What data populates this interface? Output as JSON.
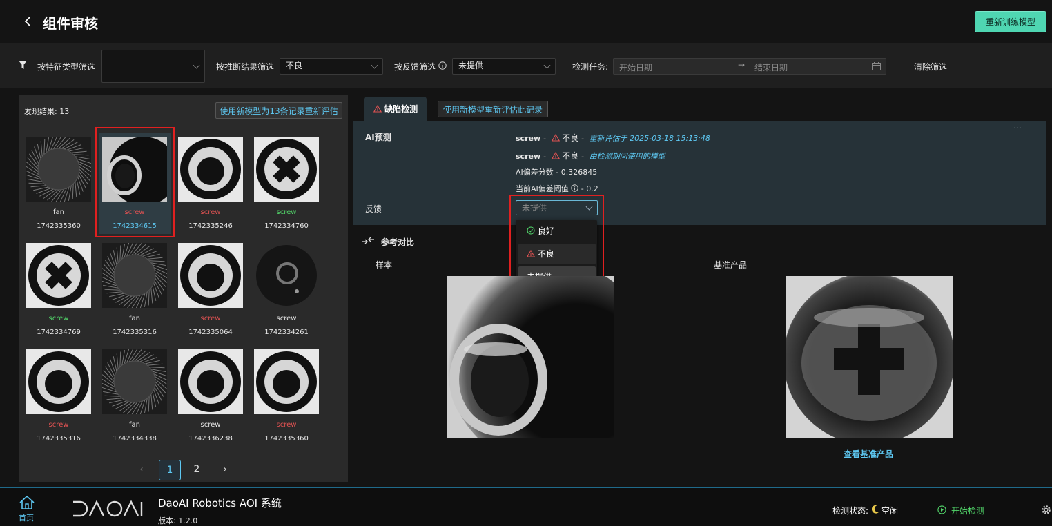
{
  "header": {
    "title": "组件审核",
    "retrain_label": "重新训练模型"
  },
  "filters": {
    "feature_label": "按特征类型筛选",
    "feature_value": "",
    "result_label": "按推断结果筛选",
    "result_value": "不良",
    "feedback_label": "按反馈筛选",
    "feedback_value": "未提供",
    "task_label": "检测任务:",
    "start_placeholder": "开始日期",
    "end_placeholder": "结束日期",
    "clear_label": "清除筛选"
  },
  "results": {
    "count_label": "发现结果: 13",
    "reeval_all_label": "使用新模型为13条记录重新评估",
    "items": [
      {
        "label": "fan",
        "timestamp": "1742335360",
        "status": "neutral",
        "kind": "fan"
      },
      {
        "label": "screw",
        "timestamp": "1742334615",
        "status": "bad",
        "kind": "screw-side",
        "selected": true
      },
      {
        "label": "screw",
        "timestamp": "1742335246",
        "status": "bad",
        "kind": "screw-hole"
      },
      {
        "label": "screw",
        "timestamp": "1742334760",
        "status": "good",
        "kind": "screw-cross"
      },
      {
        "label": "screw",
        "timestamp": "1742334769",
        "status": "good",
        "kind": "screw-cross"
      },
      {
        "label": "fan",
        "timestamp": "1742335316",
        "status": "neutral",
        "kind": "fan"
      },
      {
        "label": "screw",
        "timestamp": "1742335064",
        "status": "bad",
        "kind": "screw-hole"
      },
      {
        "label": "screw",
        "timestamp": "1742334261",
        "status": "neutral",
        "kind": "screw-dark"
      },
      {
        "label": "screw",
        "timestamp": "1742335316",
        "status": "bad",
        "kind": "screw-hole"
      },
      {
        "label": "fan",
        "timestamp": "1742334338",
        "status": "neutral",
        "kind": "fan"
      },
      {
        "label": "screw",
        "timestamp": "1742336238",
        "status": "neutral",
        "kind": "screw-hole"
      },
      {
        "label": "screw",
        "timestamp": "1742335360",
        "status": "bad",
        "kind": "screw-hole"
      }
    ],
    "pages": [
      "1",
      "2"
    ],
    "current_page": "1"
  },
  "detail": {
    "tab_label": "缺陷检测",
    "reeval_one_label": "使用新模型重新评估此记录",
    "ai_title": "AI预测",
    "pred1": {
      "name": "screw",
      "result": "不良",
      "note": "重新评估于 2025-03-18 15:13:48"
    },
    "pred2": {
      "name": "screw",
      "result": "不良",
      "note": "由检测期间使用的模型"
    },
    "score_line": "AI偏差分数 - 0.326845",
    "threshold_label": "当前AI偏差阈值",
    "threshold_value": "- 0.2",
    "feedback_title": "反馈",
    "feedback_value": "未提供",
    "dropdown": {
      "good": "良好",
      "bad": "不良",
      "none": "未提供"
    },
    "compare_title": "参考对比",
    "sample_label": "样本",
    "reference_label": "基准产品",
    "view_reference": "查看基准产品"
  },
  "footer": {
    "home_label": "首页",
    "logo_text": "DAOAI",
    "app_name": "DaoAI Robotics AOI 系统",
    "version": "版本: 1.2.0",
    "status_label": "检测状态:",
    "status_value": "空闲",
    "start_label": "开始检测"
  },
  "colors": {
    "accent": "#5ec8f2",
    "good": "#52d66a",
    "bad": "#e05252",
    "primary_btn": "#4fd6b2"
  }
}
